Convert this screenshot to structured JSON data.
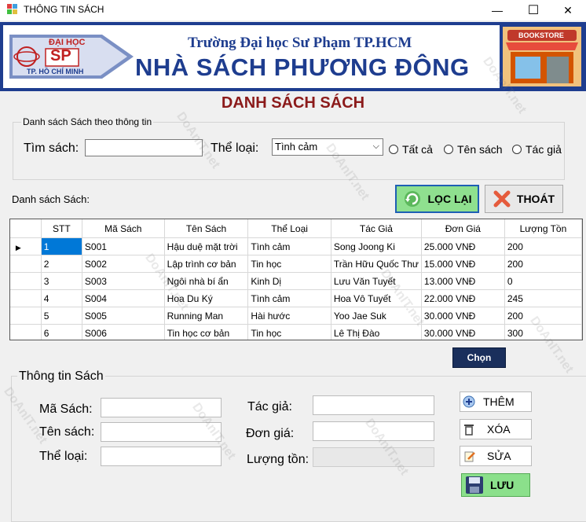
{
  "window": {
    "title": "THÔNG TIN SÁCH",
    "minimize_glyph": "—",
    "maximize_glyph": "☐",
    "close_glyph": "✕"
  },
  "banner": {
    "logo_top": "ĐẠI HỌC",
    "logo_mid": "SP",
    "logo_bottom": "TP. HỒ CHÍ MINH",
    "university": "Trường Đại học Sư Phạm TP.HCM",
    "store_name": "NHÀ SÁCH PHƯƠNG ĐÔNG",
    "bookstore_sign": "BOOKSTORE"
  },
  "heading": "DANH SÁCH SÁCH",
  "filter": {
    "group_title": "Danh sách Sách theo thông tin",
    "search_label": "Tìm sách:",
    "search_value": "",
    "genre_label": "Thể loại:",
    "genre_selected": "Tình cảm",
    "radios": [
      "Tất cả",
      "Tên sách",
      "Tác giả"
    ]
  },
  "list_label": "Danh sách Sách:",
  "buttons": {
    "refresh": "LỌC LẠI",
    "exit": "THOÁT",
    "choose": "Chọn",
    "add": "THÊM",
    "delete": "XÓA",
    "edit": "SỬA",
    "save": "LƯU"
  },
  "table": {
    "columns": [
      "STT",
      "Mã Sách",
      "Tên Sách",
      "Thể Loại",
      "Tác Giả",
      "Đơn Giá",
      "Lượng Tồn"
    ],
    "rows": [
      [
        "1",
        "S001",
        "Hậu duệ mặt trời",
        "Tình cảm",
        "Song Joong Ki",
        "25.000 VNĐ",
        "200"
      ],
      [
        "2",
        "S002",
        "Lập trình cơ bản",
        "Tin học",
        "Trần Hữu Quốc Thư",
        "15.000 VNĐ",
        "200"
      ],
      [
        "3",
        "S003",
        "Ngôi nhà bí ẩn",
        "Kinh Dị",
        "Lưu Văn Tuyết",
        "13.000 VNĐ",
        "0"
      ],
      [
        "4",
        "S004",
        "Hoa Du Ký",
        "Tình cảm",
        "Hoa Vô Tuyết",
        "22.000 VNĐ",
        "245"
      ],
      [
        "5",
        "S005",
        "Running Man",
        "Hài hước",
        "Yoo Jae Suk",
        "30.000 VNĐ",
        "200"
      ],
      [
        "6",
        "S006",
        "Tin học cơ bản",
        "Tin học",
        "Lê Thị Đào",
        "30.000 VNĐ",
        "300"
      ]
    ]
  },
  "info": {
    "group_title": "Thông tin Sách",
    "labels": {
      "code": "Mã Sách:",
      "name": "Tên sách:",
      "genre": "Thể loại:",
      "author": "Tác giả:",
      "price": "Đơn giá:",
      "stock": "Lượng tồn:"
    },
    "values": {
      "code": "",
      "name": "",
      "genre": "",
      "author": "",
      "price": "",
      "stock": ""
    }
  },
  "watermark": "DoAnIT.net",
  "colors": {
    "accent_blue": "#1e3d8f",
    "heading_red": "#8b1a1a",
    "selection": "#0078d7",
    "save_green": "#8be08b"
  }
}
